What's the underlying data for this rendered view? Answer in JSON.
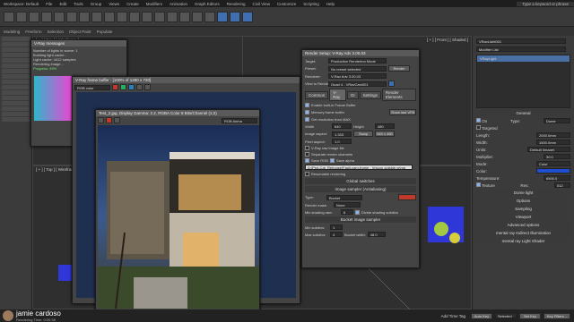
{
  "window": {
    "title": "Workspace: Default",
    "menu": [
      "File",
      "Edit",
      "Tools",
      "Group",
      "Views",
      "Create",
      "Modifiers",
      "Animation",
      "Graph Editors",
      "Rendering",
      "Civil View",
      "Customize",
      "Scripting",
      "Help"
    ],
    "search_placeholder": "Type a keyword or phrase"
  },
  "ribbon": {
    "items": [
      "Modeling",
      "Freeform",
      "Selection",
      "Object Paint",
      "Populate"
    ]
  },
  "viewports": {
    "top_label": "[ + ] [ Top ] [ Wireframe ]",
    "front_label": "[ + ] [ Front ] [ Shaded ]",
    "left_label": "[ + ] [ Top ] [ Wireframe ]"
  },
  "vray_messages": {
    "title": "V-Ray messages",
    "lines": [
      "Number of lights in scene: 1",
      "Building light cache...",
      "Light cache: 4412 samples",
      "Rendering image...",
      "Progress: 45%"
    ]
  },
  "vfb_main": {
    "title": "V-Ray frame buffer - [100% of 1280 x 720]",
    "channel": "RGB color"
  },
  "vfb_small": {
    "title": "Test_2.jpg, Display Gamma: 2.2, RGBA Color 8 Bits/Channel (1:2)",
    "channel": "RGB Alpha"
  },
  "render_setup": {
    "title": "Render Setup: V-Ray Adv 3.00.03",
    "target_label": "Target:",
    "target_value": "Production Rendering Mode",
    "preset_label": "Preset:",
    "preset_value": "No preset selected",
    "renderer_label": "Renderer:",
    "renderer_value": "V-Ray Adv 3.00.03",
    "view_label": "View to Render:",
    "view_value": "Quad 4 - VRayCam001",
    "render_btn": "Render",
    "tabs": [
      "Common",
      "V-Ray",
      "GI",
      "Settings",
      "Render Elements"
    ],
    "checks": [
      "Enable built-in Frame Buffer",
      "Memory frame buffer"
    ],
    "show_last_btn": "Show last VFB",
    "get_res_label": "Get resolution from MAX",
    "width_label": "Width",
    "width_value": "640",
    "height_label": "Height",
    "height_value": "480",
    "image_aspect_label": "Image aspect:",
    "image_aspect_value": "1.333",
    "pixel_aspect_label": "Pixel aspect:",
    "pixel_aspect_value": "1.0",
    "swap_btn": "Swap",
    "res_btn": "640 x 480",
    "raw_label": "V-Ray raw image file",
    "separate_label": "Separate render channels",
    "save_rgb": "Save RGB",
    "save_alpha": "Save alpha",
    "path_value": "D:\\Proj-Cat_Rehouse\\Fagli-cam-frame - Vrscon outside.vrimg",
    "resumable_label": "Resumable rendering",
    "global_switches": "Global switches",
    "image_sampler": "Image sampler (Antialiasing)",
    "type_label": "Type:",
    "type_value": "Bucket",
    "render_mask_label": "Render mask:",
    "render_mask_value": "None",
    "min_shading_label": "Min shading rate:",
    "min_shading_value": "6",
    "divide_label": "Divide shading subdivs",
    "bucket_sampler": "Bucket image sampler",
    "min_subdivs_label": "Min subdivs:",
    "min_subdivs_value": "1",
    "max_subdivs_label": "Max subdivs:",
    "max_subdivs_value": "4",
    "bucket_width_label": "Bucket width:",
    "bucket_width_value": "48.0"
  },
  "right_panel": {
    "object_name": "VRayLight001",
    "modifier_list": "Modifier List",
    "stack_item": "VRayLight",
    "general": "General",
    "on_label": "On",
    "type_label": "Type:",
    "type_value": "Dome",
    "targeted_label": "Targeted",
    "length_label": "Length:",
    "length_value": "2000.0mm",
    "width_label": "Width:",
    "width_value": "1500.0mm",
    "units_label": "Units:",
    "units_value": "Default (image)",
    "multiplier_label": "Multiplier:",
    "multiplier_value": "30.0",
    "mode_label": "Mode:",
    "mode_value": "Color",
    "color_label": "Color:",
    "temperature_label": "Temperature:",
    "temperature_value": "6500.0",
    "texture_label": "Texture",
    "res_label": "Res:",
    "res_value": "512",
    "rollouts": [
      "Dome light",
      "Options",
      "Sampling",
      "Viewport",
      "Advanced options",
      "mental ray Indirect Illumination",
      "mental ray Light Shader"
    ]
  },
  "status": {
    "presenter": "jamie cardoso",
    "rendering_time": "Rendering Time: 0:00:38",
    "add_time_tag": "Add Time Tag",
    "auto_key": "Auto Key",
    "selected": "Selected",
    "set_key": "Set Key",
    "key_filters": "Key Filters..."
  },
  "colors": {
    "accent_blue": "#3f6fb0",
    "vray_red": "#c0392b",
    "dome_color": "#1f4fd1"
  }
}
